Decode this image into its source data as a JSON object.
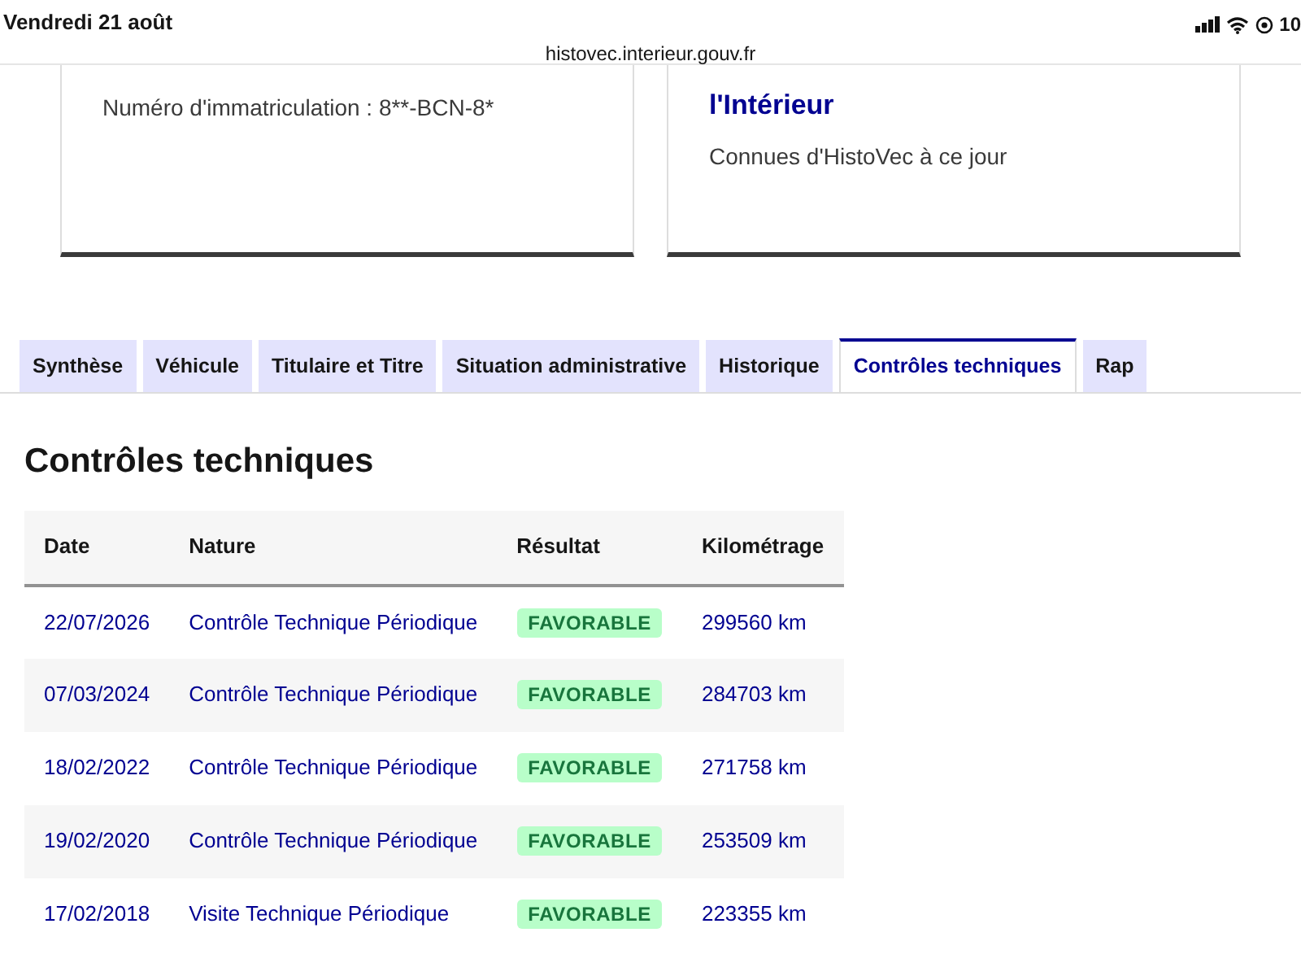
{
  "status_bar": {
    "date": "Vendredi 21 août",
    "url": "histovec.interieur.gouv.fr",
    "battery": "10"
  },
  "cards": [
    {
      "text": "Numéro d'immatriculation : 8**-BCN-8*"
    },
    {
      "title": "l'Intérieur",
      "text": "Connues d'HistoVec à ce jour"
    }
  ],
  "tabs": [
    {
      "label": "Synthèse",
      "selected": false
    },
    {
      "label": "Véhicule",
      "selected": false
    },
    {
      "label": "Titulaire et Titre",
      "selected": false
    },
    {
      "label": "Situation administrative",
      "selected": false
    },
    {
      "label": "Historique",
      "selected": false
    },
    {
      "label": "Contrôles techniques",
      "selected": true
    },
    {
      "label": "Rap",
      "selected": false
    }
  ],
  "panel": {
    "heading": "Contrôles techniques",
    "table": {
      "columns": [
        "Date",
        "Nature",
        "Résultat",
        "Kilométrage"
      ],
      "rows": [
        {
          "date": "22/07/2026",
          "nature": "Contrôle Technique Périodique",
          "result": "FAVORABLE",
          "km": "299560 km"
        },
        {
          "date": "07/03/2024",
          "nature": "Contrôle Technique Périodique",
          "result": "FAVORABLE",
          "km": "284703 km"
        },
        {
          "date": "18/02/2022",
          "nature": "Contrôle Technique Périodique",
          "result": "FAVORABLE",
          "km": "271758 km"
        },
        {
          "date": "19/02/2020",
          "nature": "Contrôle Technique Périodique",
          "result": "FAVORABLE",
          "km": "253509 km"
        },
        {
          "date": "17/02/2018",
          "nature": "Visite Technique Périodique",
          "result": "FAVORABLE",
          "km": "223355 km"
        }
      ]
    }
  }
}
